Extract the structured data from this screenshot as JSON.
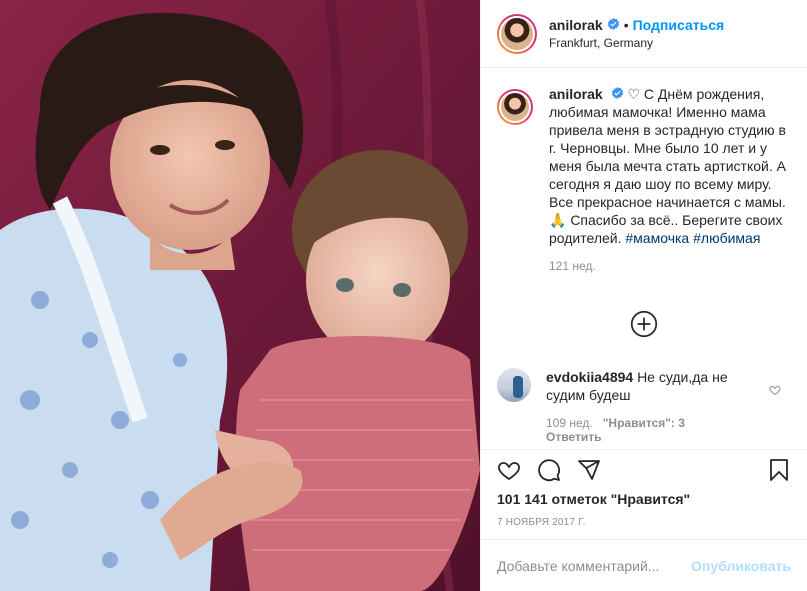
{
  "header": {
    "username": "anilorak",
    "separator": "•",
    "follow_label": "Подписаться",
    "location": "Frankfurt, Germany"
  },
  "caption": {
    "username": "anilorak",
    "heart_symbol": "♡",
    "text": " С Днём рождения, любимая мамочка! Именно мама привела меня в эстрадную студию в г. Черновцы. Мне было 10 лет и у меня была мечта стать артисткой. А сегодня я даю шоу по всему миру. Все прекрасное начинается с мамы. 🙏 Спасибо за всё.. Берегите своих родителей. ",
    "hashtags": [
      "#мамочка",
      "#любимая"
    ],
    "age": "121 нед."
  },
  "comment": {
    "username": "evdokiia4894",
    "text": "Не суди,да не судим будеш",
    "age": "109 нед.",
    "likes": "\"Нравится\": 3",
    "reply_label": "Ответить"
  },
  "likes_text": "101 141 отметок \"Нравится\"",
  "date": "7 НОЯБРЯ 2017 Г.",
  "add_comment": {
    "placeholder": "Добавьте комментарий...",
    "publish_label": "Опубликовать"
  },
  "colors": {
    "link_blue": "#0095f6",
    "hashtag": "#00376b",
    "muted": "#8e8e8e",
    "publish_disabled": "#b2dffc",
    "photo_backdrop": "#7a1d3d"
  },
  "icons": [
    "verified-icon",
    "heart-icon",
    "comment-icon",
    "share-icon",
    "bookmark-icon",
    "add-comments-icon",
    "small-heart-icon"
  ]
}
